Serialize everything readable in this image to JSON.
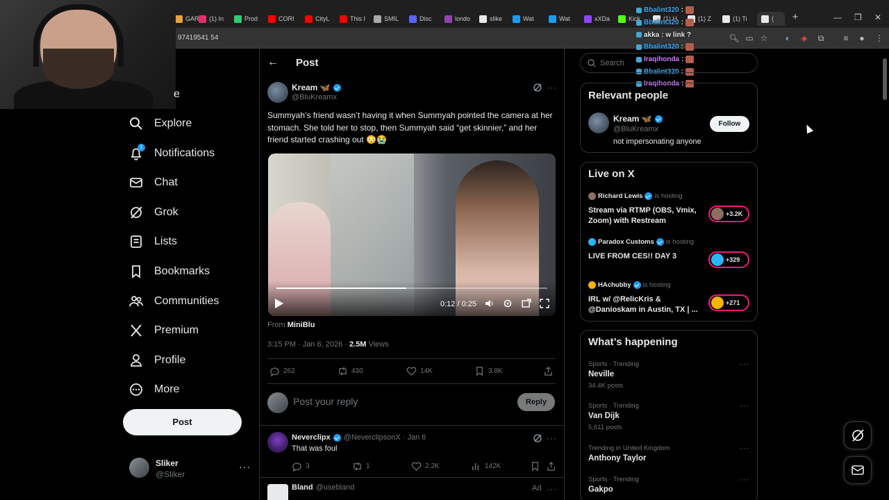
{
  "browser": {
    "tabs": [
      {
        "label": "GARI",
        "color": "#e6a23c"
      },
      {
        "label": "(1) In",
        "color": "#e1306c"
      },
      {
        "label": "Prod",
        "color": "#2ecc71"
      },
      {
        "label": "CORI",
        "color": "#ff0000"
      },
      {
        "label": "CityL",
        "color": "#ff0000"
      },
      {
        "label": "This I",
        "color": "#ff0000"
      },
      {
        "label": "SMIL",
        "color": "#aaaaaa"
      },
      {
        "label": "Disc",
        "color": "#5865f2"
      },
      {
        "label": "londo",
        "color": "#8e44ad"
      },
      {
        "label": "slike",
        "color": "#e7e9ea"
      },
      {
        "label": "Wat",
        "color": "#1d9bf0"
      },
      {
        "label": "Wat",
        "color": "#1d9bf0"
      },
      {
        "label": "xXDa",
        "color": "#9146ff"
      },
      {
        "label": "Kick",
        "color": "#53fc18"
      },
      {
        "label": "(1) H",
        "color": "#e7e9ea"
      },
      {
        "label": "(1) Z",
        "color": "#e7e9ea"
      },
      {
        "label": "(1) Ti",
        "color": "#e7e9ea"
      },
      {
        "label": "(",
        "color": "#e7e9ea"
      }
    ],
    "url": "97419541 54"
  },
  "chat": [
    {
      "user": "Bbalint320",
      "text": ":",
      "color": "#3fa9f5",
      "emote": true
    },
    {
      "user": "Bbalint320",
      "text": ":",
      "color": "#3fa9f5",
      "emote": true
    },
    {
      "user": "akka",
      "text": ": w link ?",
      "color": "#e7e9ea",
      "emote": false
    },
    {
      "user": "Bbalint320",
      "text": ":",
      "color": "#3fa9f5",
      "emote": true
    },
    {
      "user": "Iraqihonda",
      "text": ":",
      "color": "#c77dff",
      "emote": true
    },
    {
      "user": "Bbalint320",
      "text": ":",
      "color": "#3fa9f5",
      "emote": true
    },
    {
      "user": "Iraqihonda",
      "text": ":",
      "color": "#c77dff",
      "emote": true
    }
  ],
  "nav": {
    "home_partial": "e",
    "items": [
      {
        "label": "Explore",
        "icon": "search-icon"
      },
      {
        "label": "Notifications",
        "icon": "bell-icon"
      },
      {
        "label": "Chat",
        "icon": "mail-icon"
      },
      {
        "label": "Grok",
        "icon": "grok-icon"
      },
      {
        "label": "Lists",
        "icon": "list-icon"
      },
      {
        "label": "Bookmarks",
        "icon": "bookmark-icon"
      },
      {
        "label": "Communities",
        "icon": "people-icon"
      },
      {
        "label": "Premium",
        "icon": "x-logo-icon"
      },
      {
        "label": "Profile",
        "icon": "person-icon"
      },
      {
        "label": "More",
        "icon": "more-circle-icon"
      }
    ],
    "notif_count": "1",
    "post_label": "Post",
    "account": {
      "name": "Sliker",
      "handle": "@Sliker"
    }
  },
  "post": {
    "header_title": "Post",
    "author": {
      "name": "Kream 🦋",
      "handle": "@BluKreamx"
    },
    "text": "Summyah’s friend wasn’t having it when Summyah pointed the camera at her stomach. She told her to stop, then Summyah said “get skinnier,” and her friend started crashing out 😳😭",
    "video": {
      "time": "0:12 / 0:25",
      "progress": 0.48
    },
    "from_prefix": "From",
    "from_source": "MiniBlu",
    "timestamp": "3:15 PM · Jan 6, 2026 ·",
    "views_count": "2.5M",
    "views_label": "Views",
    "actions": {
      "replies": "262",
      "reposts": "430",
      "likes": "14K",
      "bookmarks": "3.8K"
    },
    "reply_placeholder": "Post your reply",
    "reply_button": "Reply"
  },
  "comments": [
    {
      "name": "Neverclipx",
      "handle": "@NeverclipsonX · Jan 6",
      "text": "That was foul",
      "replies": "3",
      "reposts": "1",
      "likes": "2.2K",
      "views": "142K"
    }
  ],
  "ad": {
    "name": "Bland",
    "handle": "@usebland",
    "label": "Ad"
  },
  "sidebar": {
    "search_placeholder": "Search",
    "relevant_title": "Relevant people",
    "relevant": {
      "name": "Kream 🦋",
      "handle": "@BluKreamx",
      "bio": "not impersonating anyone",
      "follow_label": "Follow"
    },
    "live_title": "Live on X",
    "live": [
      {
        "host": "Richard Lewis",
        "hosting": "is hosting",
        "title": "Stream via RTMP (OBS, Vmix, Zoom) with Restream",
        "count": "+3.2K",
        "avatar_color": "#8d6e63"
      },
      {
        "host": "Paradox Customs",
        "hosting": "is hosting",
        "title": "LIVE FROM CES!! DAY 3",
        "count": "+329",
        "avatar_color": "#29b6f6"
      },
      {
        "host": "HAchubby",
        "hosting": "is hosting",
        "title": "IRL w/ @RelicKris & @Danioskam in Austin, TX | ...",
        "count": "+271",
        "avatar_color": "#f4b400"
      }
    ],
    "happening_title": "What’s happening",
    "trends": [
      {
        "category": "Sports · Trending",
        "name": "Neville",
        "count": "34.4K posts"
      },
      {
        "category": "Sports · Trending",
        "name": "Van Dijk",
        "count": "5,611 posts"
      },
      {
        "category": "Trending in United Kingdom",
        "name": "Anthony Taylor",
        "count": ""
      },
      {
        "category": "Sports · Trending",
        "name": "Gakpo",
        "count": ""
      }
    ]
  }
}
